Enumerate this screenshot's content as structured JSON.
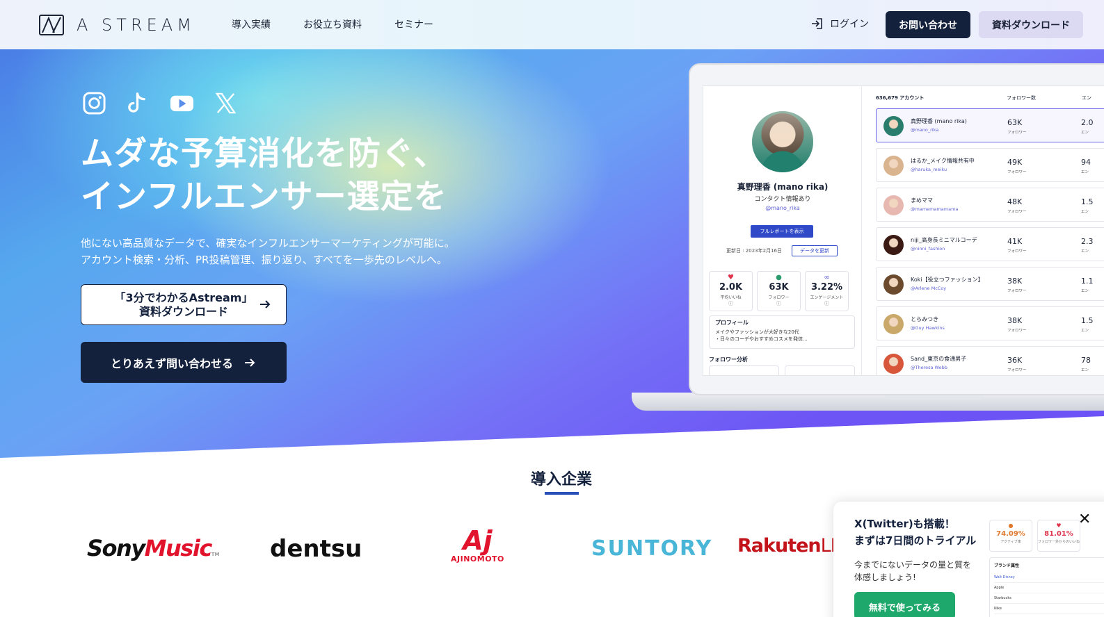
{
  "header": {
    "logo_text": "A STREAM",
    "nav": [
      "導入実績",
      "お役立ち資料",
      "セミナー"
    ],
    "login_label": "ログイン",
    "contact_label": "お問い合わせ",
    "download_label": "資料ダウンロード"
  },
  "hero": {
    "socials": [
      "instagram-icon",
      "tiktok-icon",
      "youtube-icon",
      "x-icon"
    ],
    "title_line1": "ムダな予算消化を防ぐ、",
    "title_line2": "インフルエンサー選定を",
    "sub_line1": "他にない高品質なデータで、確実なインフルエンサーマーケティングが可能に。",
    "sub_line2": "アカウント検索・分析、PR投稿管理、振り返り、すべてを一歩先のレベルへ。",
    "cta1_line1": "「3分でわかるAstream」",
    "cta1_line2": "資料ダウンロード",
    "cta2": "とりあえず問い合わせる"
  },
  "app": {
    "profile": {
      "name": "真野理香 (mano rika)",
      "contact": "コンタクト情報あり",
      "handle": "@mano_rika",
      "report_button": "フルレポートを表示",
      "updated": "更新日 : 2023年2月16日",
      "refresh_button": "データを更新",
      "stats": [
        {
          "value": "2.0K",
          "label": "平均いいね",
          "color": "#e0344d",
          "icon": "♥"
        },
        {
          "value": "63K",
          "label": "フォロワー",
          "color": "#2c9b6e",
          "icon": "●"
        },
        {
          "value": "3.22%",
          "label": "エンゲージメント",
          "color": "#5b5fd4",
          "icon": "∞"
        }
      ],
      "profile_heading": "プロフィール",
      "profile_line1": "メイクやファッションが大好きな20代",
      "profile_line2": "・日々のコーデやおすすめコスメを発信...",
      "follower_analysis": "フォロワー分析"
    },
    "list": {
      "count_label": "636,679 アカウント",
      "col_followers": "フォロワー数",
      "col_engagement": "エン",
      "rows": [
        {
          "name": "真野理香 (mano rika)",
          "handle": "@mano_rika",
          "followers": "63K",
          "followers_label": "フォロワー",
          "eng": "2.0",
          "eng_label": "エン",
          "avatar": "#2a7d6c"
        },
        {
          "name": "はるか_メイク情報共有中",
          "handle": "@haruka_meiku",
          "followers": "49K",
          "followers_label": "フォロワー",
          "eng": "94",
          "eng_label": "エン",
          "avatar": "#d9b48f"
        },
        {
          "name": "まめママ",
          "handle": "@mamemamamama",
          "followers": "48K",
          "followers_label": "フォロワー",
          "eng": "1.5",
          "eng_label": "エン",
          "avatar": "#e7b8b0"
        },
        {
          "name": "niji_高身長ミニマルコーデ",
          "handle": "@ninni_fashion",
          "followers": "41K",
          "followers_label": "フォロワー",
          "eng": "2.3",
          "eng_label": "エン",
          "avatar": "#3a1a12"
        },
        {
          "name": "Koki【役立つファッション】",
          "handle": "@Arlene McCoy",
          "followers": "38K",
          "followers_label": "フォロワー",
          "eng": "1.1",
          "eng_label": "エン",
          "avatar": "#6b4a2e"
        },
        {
          "name": "とらみつき",
          "handle": "@Guy Hawkins",
          "followers": "38K",
          "followers_label": "フォロワー",
          "eng": "1.5",
          "eng_label": "エン",
          "avatar": "#c9a86a"
        },
        {
          "name": "Sand_東京の食通男子",
          "handle": "@Theresa Webb",
          "followers": "36K",
          "followers_label": "フォロワー",
          "eng": "78",
          "eng_label": "エン",
          "avatar": "#d8563a"
        }
      ]
    }
  },
  "clients": {
    "title": "導入企業",
    "logos": {
      "sony_a": "Sony",
      "sony_b": "Music",
      "sony_tm": "TM",
      "dentsu": "dentsu",
      "ajinomoto_mark": "Aj",
      "ajinomoto_text": "AJINOMOTO",
      "suntory": "SUNTORY",
      "rakuten_a": "Rakuten",
      "rakuten_b": "LINK"
    }
  },
  "popup": {
    "title_line1": "X(Twitter)も搭載！",
    "title_line2": "まずは7日間のトライアル",
    "body_line1": "今までにないデータの量と質を",
    "body_line2": "体感しましょう!",
    "button": "無料で使ってみる",
    "close": "✕",
    "cards": [
      {
        "value": "74.09%",
        "label": "アクティブ率",
        "color": "#e07a2e",
        "icon": "●"
      },
      {
        "value": "81.01%",
        "label": "フォロワー外からのいいね",
        "color": "#e0344d",
        "icon": "♥"
      }
    ],
    "table_heading": "ブランド属性",
    "table_rows": [
      "Walt Disney",
      "Apple",
      "Starbucks",
      "Nike"
    ]
  }
}
